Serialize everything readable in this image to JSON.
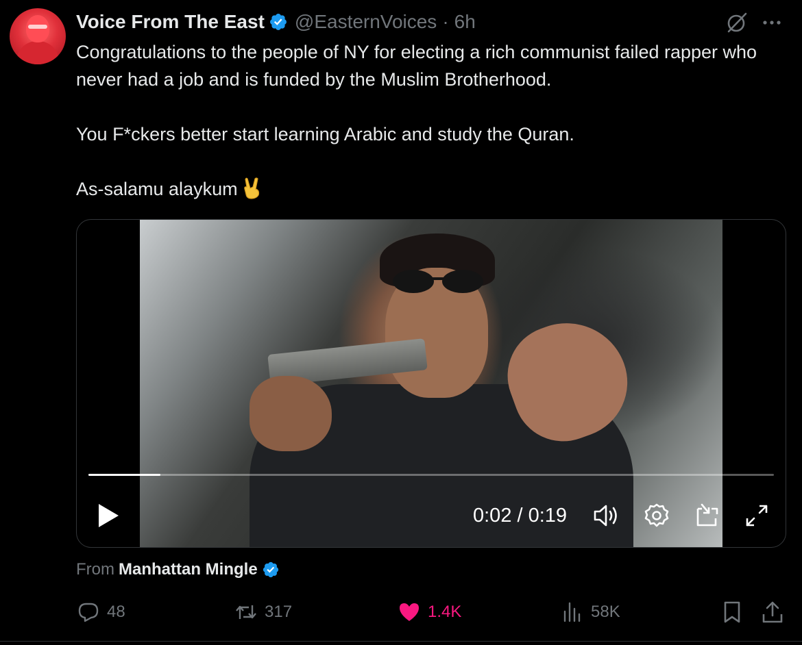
{
  "author": {
    "name": "Voice From The East",
    "handle": "@EasternVoices",
    "separator": "·",
    "time": "6h",
    "verified": true,
    "verified_color": "#1d9bf0"
  },
  "tweet": {
    "paragraphs": [
      "Congratulations to the people of NY for electing a rich communist failed rapper who never had a job and is funded by the Muslim Brotherhood.",
      "You F*ckers better start learning Arabic and study the Quran.",
      "As-salamu alaykum"
    ],
    "emoji": "victory-hand-emoji"
  },
  "video": {
    "time_display": "0:02 / 0:19",
    "progress_fraction": 0.105,
    "controls": [
      "play-icon",
      "volume-icon",
      "settings-icon",
      "picture-in-picture-icon",
      "fullscreen-icon"
    ]
  },
  "source": {
    "label": "From",
    "name": "Manhattan Mingle",
    "verified": true
  },
  "actions": {
    "replies": "48",
    "reposts": "317",
    "likes": "1.4K",
    "liked": true,
    "views": "58K",
    "like_color": "#f91880",
    "muted_color": "#71767b"
  },
  "icons": [
    "grok-icon",
    "more-icon",
    "reply-icon",
    "repost-icon",
    "heart-icon",
    "views-icon",
    "bookmark-icon",
    "share-icon"
  ]
}
